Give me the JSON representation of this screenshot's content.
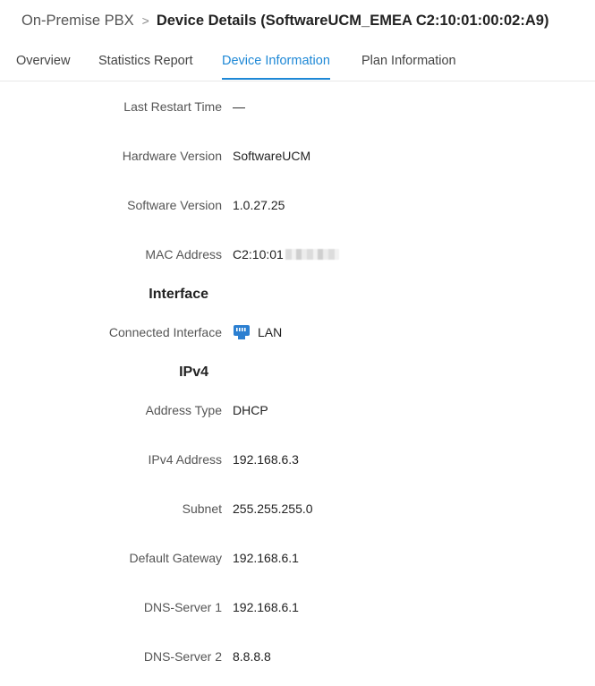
{
  "breadcrumb": {
    "parent": "On-Premise PBX",
    "separator": ">",
    "current": "Device Details (SoftwareUCM_EMEA C2:10:01:00:02:A9)"
  },
  "tabs": [
    {
      "label": "Overview",
      "active": false
    },
    {
      "label": "Statistics Report",
      "active": false
    },
    {
      "label": "Device Information",
      "active": true
    },
    {
      "label": "Plan Information",
      "active": false
    }
  ],
  "device": {
    "last_restart_label": "Last Restart Time",
    "last_restart_value": "—",
    "hardware_version_label": "Hardware Version",
    "hardware_version_value": "SoftwareUCM",
    "software_version_label": "Software Version",
    "software_version_value": "1.0.27.25",
    "mac_label": "MAC Address",
    "mac_value": "C2:10:01"
  },
  "interface": {
    "title": "Interface",
    "connected_label": "Connected Interface",
    "connected_value": "LAN",
    "connected_icon": "ethernet-port-icon"
  },
  "ipv4": {
    "title": "IPv4",
    "address_type_label": "Address Type",
    "address_type_value": "DHCP",
    "address_label": "IPv4 Address",
    "address_value": "192.168.6.3",
    "subnet_label": "Subnet",
    "subnet_value": "255.255.255.0",
    "gateway_label": "Default Gateway",
    "gateway_value": "192.168.6.1",
    "dns1_label": "DNS-Server 1",
    "dns1_value": "192.168.6.1",
    "dns2_label": "DNS-Server 2",
    "dns2_value": "8.8.8.8"
  },
  "colors": {
    "accent": "#1e88d6",
    "icon": "#2b7fd1"
  }
}
